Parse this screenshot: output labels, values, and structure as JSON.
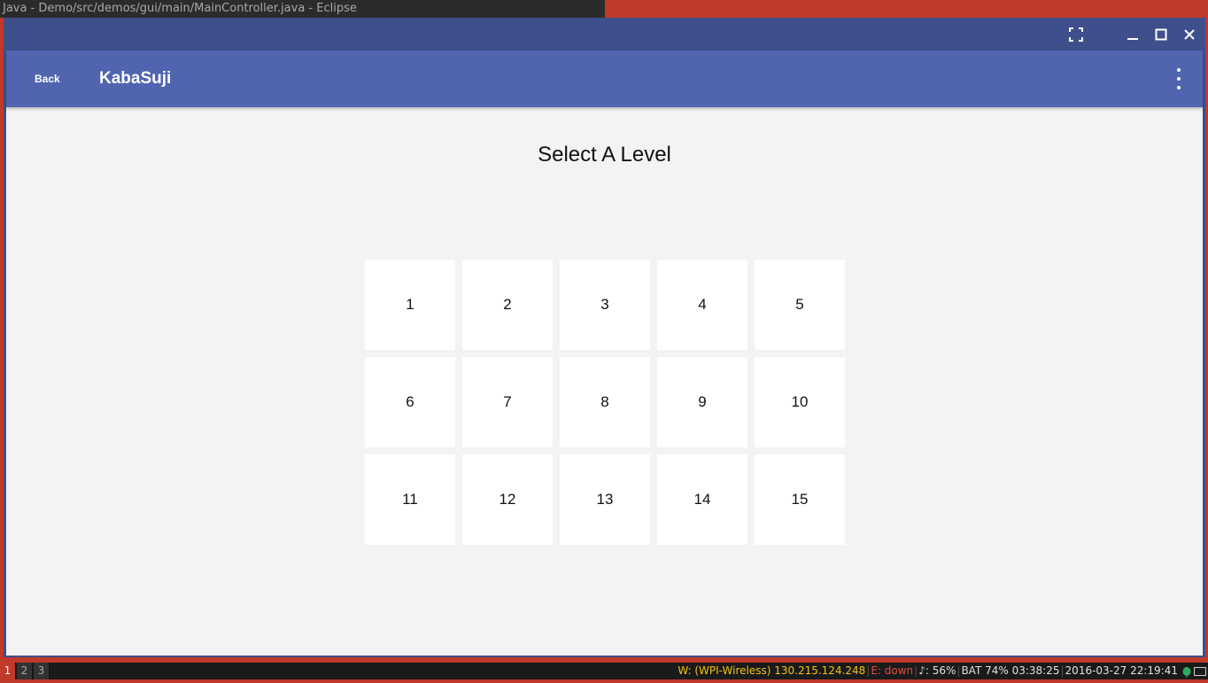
{
  "wm": {
    "window_title": "Java - Demo/src/demos/gui/main/MainController.java - Eclipse"
  },
  "window": {
    "controls": [
      "fullscreen-icon",
      "minimize-icon",
      "maximize-icon",
      "close-icon"
    ]
  },
  "appbar": {
    "back_label": "Back",
    "title": "KabaSuji",
    "more_icon": "more-vert-icon"
  },
  "content": {
    "title": "Select A Level",
    "levels": [
      "1",
      "2",
      "3",
      "4",
      "5",
      "6",
      "7",
      "8",
      "9",
      "10",
      "11",
      "12",
      "13",
      "14",
      "15"
    ]
  },
  "statusbar": {
    "workspaces": [
      "1",
      "2",
      "3"
    ],
    "active_workspace": "1",
    "wifi": "W: (WPI-Wireless) 130.215.124.248",
    "ethernet": "E: down",
    "volume": "♪: 56%",
    "battery": "BAT 74% 03:38:25",
    "datetime": "2016-03-27 22:19:41"
  },
  "colors": {
    "titlebar": "#3f4f8c",
    "appbar": "#5064b0",
    "content_bg": "#f3f3f3",
    "wm_accent": "#c0392b",
    "wifi_text": "#f1c40f",
    "eth_text": "#e74c3c"
  }
}
